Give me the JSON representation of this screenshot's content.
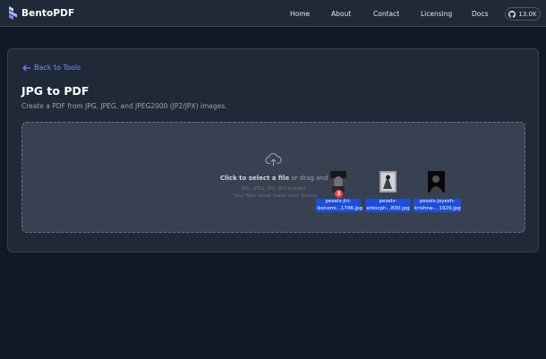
{
  "header": {
    "brand": "BentoPDF",
    "nav": [
      {
        "label": "Home"
      },
      {
        "label": "About"
      },
      {
        "label": "Contact"
      },
      {
        "label": "Licensing"
      },
      {
        "label": "Docs"
      }
    ],
    "github_stars": "13.0K"
  },
  "tool": {
    "back_label": "Back to Tools",
    "title": "JPG to PDF",
    "description": "Create a PDF from JPG, JPEG, and JPEG2000 (JP2/JPX) images."
  },
  "dropzone": {
    "action_strong": "Click to select a file",
    "action_rest": " or drag and drop",
    "accepted_types": "JPG, JPEG, JP2, JPX Images",
    "privacy_note": "Your files never leave your device.",
    "drag_badge_count": "3",
    "files": [
      {
        "name_line1": "pexels-jiri-",
        "name_line2": "ikonomi...1746.jpg"
      },
      {
        "name_line1": "pexels-",
        "name_line2": "erkocph...830.jpg"
      },
      {
        "name_line1": "pexels-jayesh-",
        "name_line2": "krishna-...1929.jpg"
      }
    ]
  },
  "colors": {
    "background": "#111827",
    "surface": "#1f2937",
    "accent": "#818cf8",
    "file_chip": "#1d4ed8",
    "badge": "#ef4444"
  },
  "icons": [
    "bentopdf-logo-icon",
    "github-icon",
    "arrow-left-icon",
    "cloud-upload-icon"
  ]
}
